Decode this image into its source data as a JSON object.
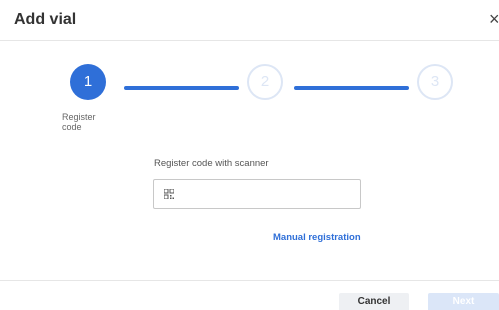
{
  "dialog": {
    "title": "Add vial",
    "close_glyph": "×"
  },
  "stepper": {
    "steps": [
      {
        "number": "1",
        "label": "Register code",
        "state": "active"
      },
      {
        "number": "2",
        "label": "",
        "state": "inactive"
      },
      {
        "number": "3",
        "label": "",
        "state": "inactive"
      }
    ],
    "colors": {
      "active": "#2f6fd8",
      "inactive": "#dde6f5"
    }
  },
  "form": {
    "scanner_label": "Register code with scanner",
    "scanner_value": "",
    "scanner_placeholder": "",
    "scanner_icon": "qr-code-icon",
    "manual_link": "Manual registration"
  },
  "footer": {
    "cancel_label": "Cancel",
    "next_label": "Next"
  }
}
